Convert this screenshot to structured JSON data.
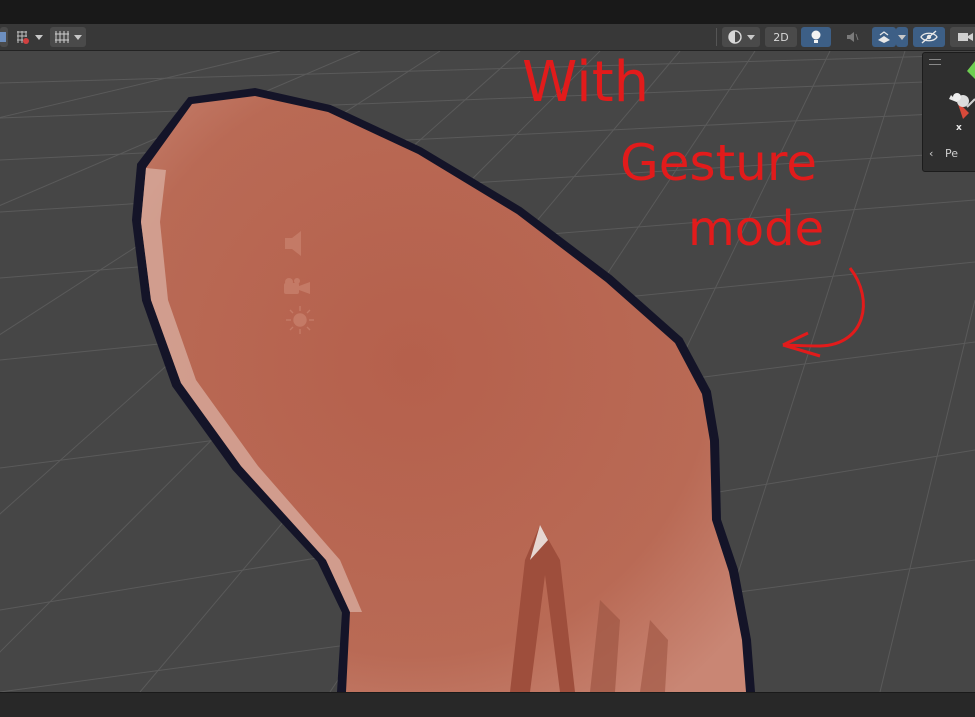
{
  "toolbar": {
    "view_2d_label": "2D",
    "left_tools": [
      "tool-move-icon",
      "grid-snap-icon",
      "grid-icon"
    ],
    "right_tools": [
      "shading-mode-icon",
      "lighting-icon",
      "audio-icon",
      "effects-icon",
      "hidden-toggle-icon",
      "camera-icon"
    ]
  },
  "scene": {
    "object": "hand-mesh",
    "gizmo_icons": [
      "audio-source-icon",
      "camera-gizmo-icon",
      "light-gizmo-icon"
    ]
  },
  "orientation_gizmo": {
    "axis_label": "x",
    "projection_label": "Pe"
  },
  "annotation": {
    "lines": [
      "With",
      "Gesture",
      "mode"
    ],
    "color": "#e21b1b"
  },
  "colors": {
    "toolbar_bg": "#383838",
    "viewport_bg": "#464646",
    "active_button": "#3d5f86",
    "mesh": "#b5604c",
    "outline": "#141428"
  }
}
